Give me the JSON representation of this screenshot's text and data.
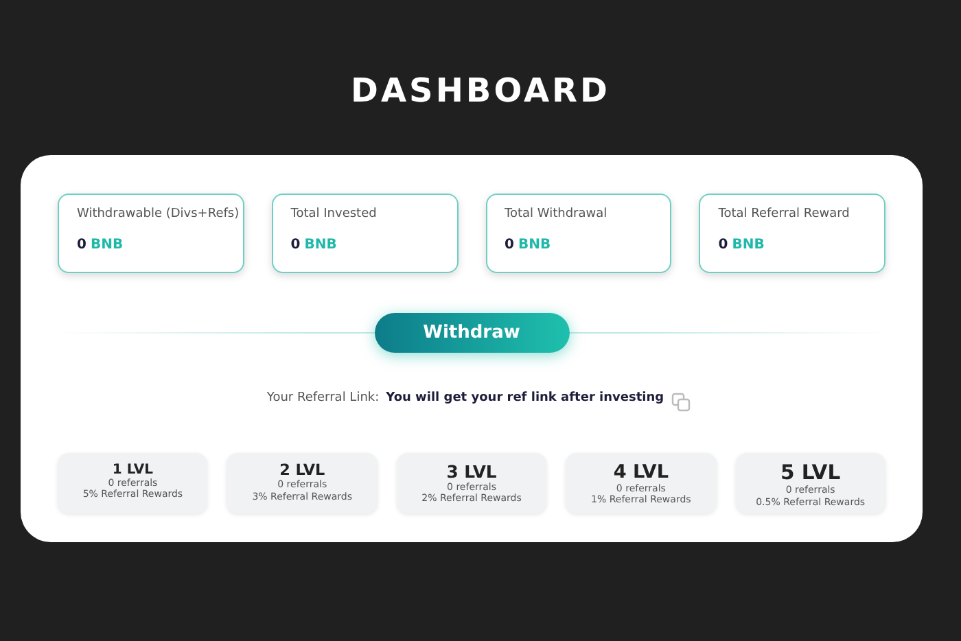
{
  "title": "DASHBOARD",
  "stats": [
    {
      "label": "Withdrawable (Divs+Refs)",
      "value": "0",
      "unit": "BNB"
    },
    {
      "label": "Total Invested",
      "value": "0",
      "unit": "BNB"
    },
    {
      "label": "Total Withdrawal",
      "value": "0",
      "unit": "BNB"
    },
    {
      "label": "Total Referral Reward",
      "value": "0",
      "unit": "BNB"
    }
  ],
  "withdraw_button": "Withdraw",
  "referral": {
    "label": "Your Referral Link:",
    "value": "You will get your ref link after investing"
  },
  "levels": [
    {
      "title": "1 LVL",
      "referrals": "0 referrals",
      "reward": "5% Referral Rewards"
    },
    {
      "title": "2 LVL",
      "referrals": "0 referrals",
      "reward": "3% Referral Rewards"
    },
    {
      "title": "3 LVL",
      "referrals": "0 referrals",
      "reward": "2% Referral Rewards"
    },
    {
      "title": "4 LVL",
      "referrals": "0 referrals",
      "reward": "1% Referral Rewards"
    },
    {
      "title": "5 LVL",
      "referrals": "0 referrals",
      "reward": "0.5% Referral Rewards"
    }
  ]
}
